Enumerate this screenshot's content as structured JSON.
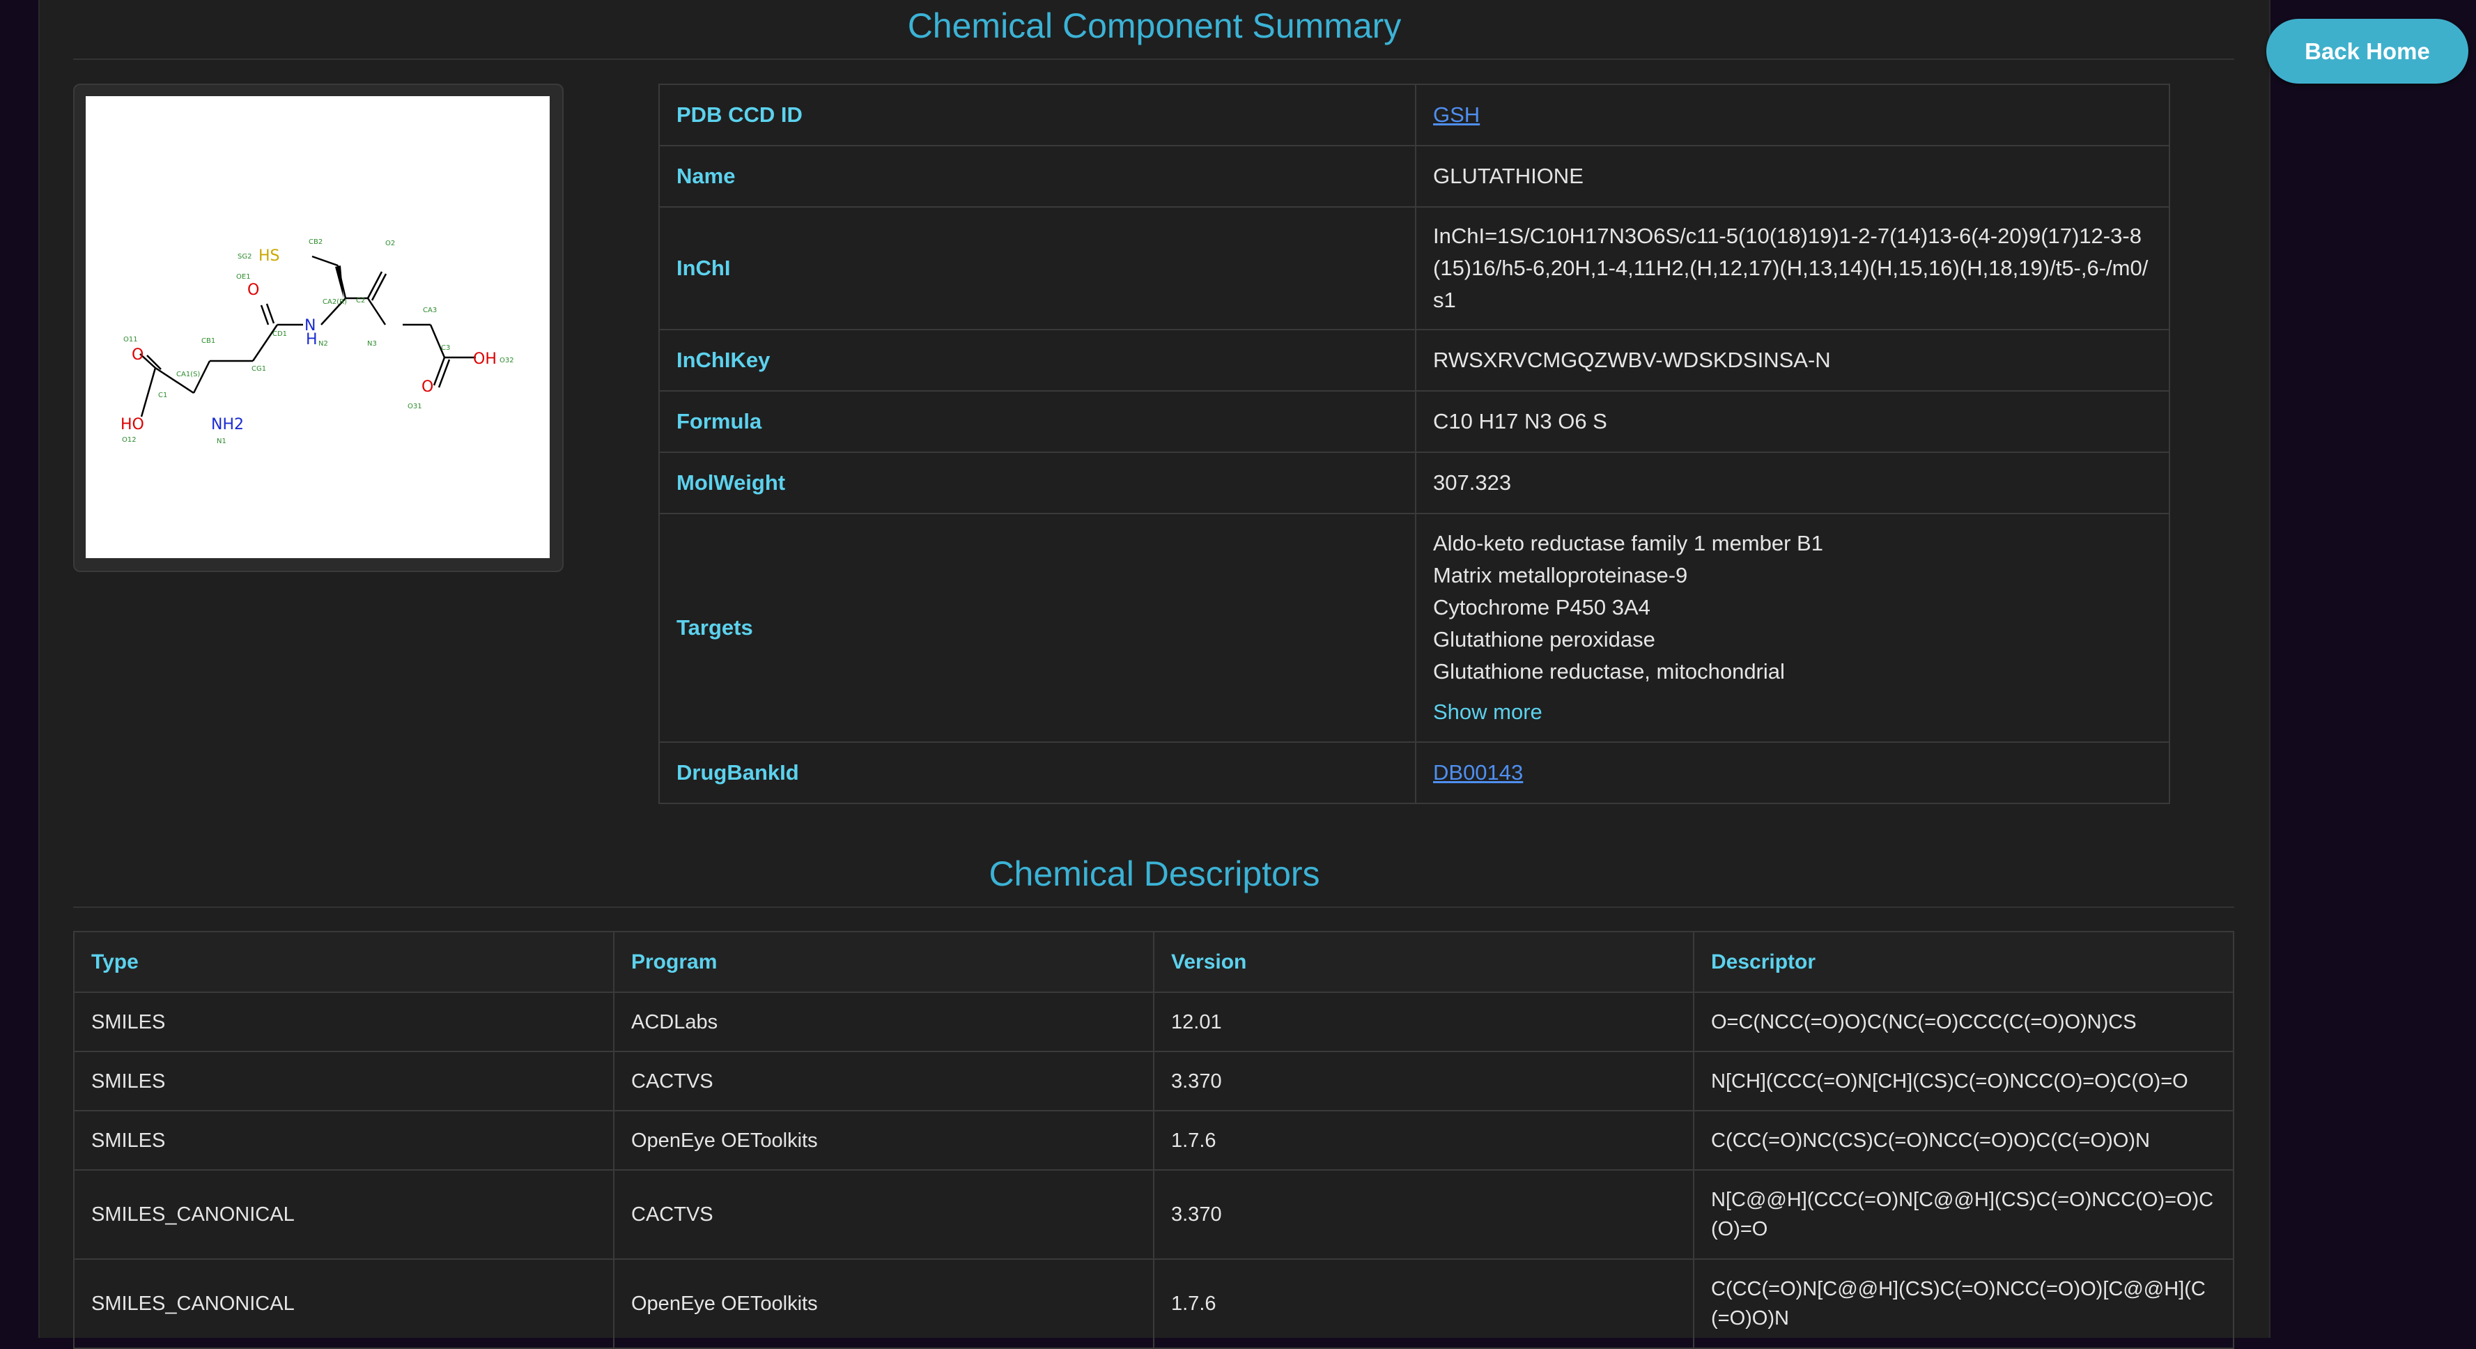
{
  "header": {
    "summary_title": "Chemical Component Summary",
    "back_home_label": "Back Home"
  },
  "colors": {
    "accent": "#3bb3d6",
    "key_text": "#5cd2ee",
    "link": "#4f8ff0",
    "button": "#3fb0cc"
  },
  "molecule_labels": [
    "SG2",
    "HS",
    "CB2",
    "O2",
    "OE1",
    "O",
    "CA2(R)",
    "C2",
    "CB1",
    "CD1",
    "N",
    "H",
    "N2",
    "N3",
    "CA3",
    "O11",
    "O",
    "C1",
    "CA1(S)",
    "CG1",
    "C3",
    "OH",
    "O32",
    "O",
    "O31",
    "HO",
    "O12",
    "NH2",
    "N1"
  ],
  "summary": {
    "pdb_ccd_id": {
      "label": "PDB CCD ID",
      "value": "GSH"
    },
    "name": {
      "label": "Name",
      "value": "GLUTATHIONE"
    },
    "inchi": {
      "label": "InChI",
      "value": "InChI=1S/C10H17N3O6S/c11-5(10(18)19)1-2-7(14)13-6(4-20)9(17)12-3-8(15)16/h5-6,20H,1-4,11H2,(H,12,17)(H,13,14)(H,15,16)(H,18,19)/t5-,6-/m0/s1"
    },
    "inchikey": {
      "label": "InChIKey",
      "value": "RWSXRVCMGQZWBV-WDSKDSINSA-N"
    },
    "formula": {
      "label": "Formula",
      "value": "C10 H17 N3 O6 S"
    },
    "molweight": {
      "label": "MolWeight",
      "value": "307.323"
    },
    "targets": {
      "label": "Targets",
      "items": [
        "Aldo-keto reductase family 1 member B1",
        "Matrix metalloproteinase-9",
        "Cytochrome P450 3A4",
        "Glutathione peroxidase",
        "Glutathione reductase, mitochondrial"
      ],
      "show_more": "Show more"
    },
    "drugbank": {
      "label": "DrugBankId",
      "value": "DB00143"
    }
  },
  "descriptors": {
    "title": "Chemical Descriptors",
    "columns": [
      "Type",
      "Program",
      "Version",
      "Descriptor"
    ],
    "rows": [
      [
        "SMILES",
        "ACDLabs",
        "12.01",
        "O=C(NCC(=O)O)C(NC(=O)CCC(C(=O)O)N)CS"
      ],
      [
        "SMILES",
        "CACTVS",
        "3.370",
        "N[CH](CCC(=O)N[CH](CS)C(=O)NCC(O)=O)C(O)=O"
      ],
      [
        "SMILES",
        "OpenEye OEToolkits",
        "1.7.6",
        "C(CC(=O)NC(CS)C(=O)NCC(=O)O)C(C(=O)O)N"
      ],
      [
        "SMILES_CANONICAL",
        "CACTVS",
        "3.370",
        "N[C@@H](CCC(=O)N[C@@H](CS)C(=O)NCC(O)=O)C(O)=O"
      ],
      [
        "SMILES_CANONICAL",
        "OpenEye OEToolkits",
        "1.7.6",
        "C(CC(=O)N[C@@H](CS)C(=O)NCC(=O)O)[C@@H](C(=O)O)N"
      ]
    ]
  }
}
